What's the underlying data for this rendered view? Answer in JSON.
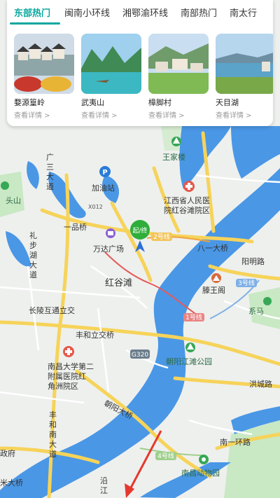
{
  "tabs": [
    {
      "label": "东部热门",
      "active": true
    },
    {
      "label": "闽南小环线",
      "active": false
    },
    {
      "label": "湘鄂渝环线",
      "active": false
    },
    {
      "label": "南部热门",
      "active": false
    },
    {
      "label": "南太行",
      "active": false
    }
  ],
  "cards": [
    {
      "title": "婺源篁岭",
      "link": "查看详情 >"
    },
    {
      "title": "武夷山",
      "link": "查看详情 >"
    },
    {
      "title": "樟脚村",
      "link": "查看详情 >"
    },
    {
      "title": "天目湖",
      "link": "查看详情 >"
    }
  ],
  "map": {
    "labels": {
      "wangjialou": "王家楼",
      "guangsanda": "广三大道",
      "toushan": "头山",
      "jiayouzhan": "加油站",
      "x012": "X012",
      "hospital": "江西省人民医院红谷滩院区",
      "yipinqiao": "一品桥",
      "qizhong": "起/终",
      "wanda": "万达广场",
      "line2": "2号线",
      "bayiqiao": "八一大桥",
      "yangmingroad": "阳明路",
      "lijiahu": "礼步湖大道",
      "honggutan": "红谷滩",
      "tengwangge": "滕王阁",
      "line3": "3号线",
      "changling": "长陵互通立交",
      "line1": "1号线",
      "xima": "系马",
      "fenghe": "丰和立交桥",
      "g320": "G320",
      "chaoyangjiangtan": "朝阳江滩公园",
      "nanchang2": "南昌大学第二附属医院红角洲院区",
      "hongchenglu": "洪城路",
      "fenghenanda": "丰和南大道",
      "chaoyangdaqiao": "朝阳大桥",
      "nanyihuan": "南一环路",
      "zhengfu": "政府",
      "line4": "4号线",
      "nanchangzoo": "南昌动物园",
      "miqiao": "米大桥",
      "yanjiang": "沿江"
    },
    "colors": {
      "water": "#4a97e6",
      "land": "#eef0ee",
      "green": "#c9e8c4",
      "road_main": "#f6d35a",
      "road_minor": "#ffffff",
      "metro": "#e45b5b",
      "accent": "#0aa7a0",
      "marker": "#2fae3b"
    }
  }
}
